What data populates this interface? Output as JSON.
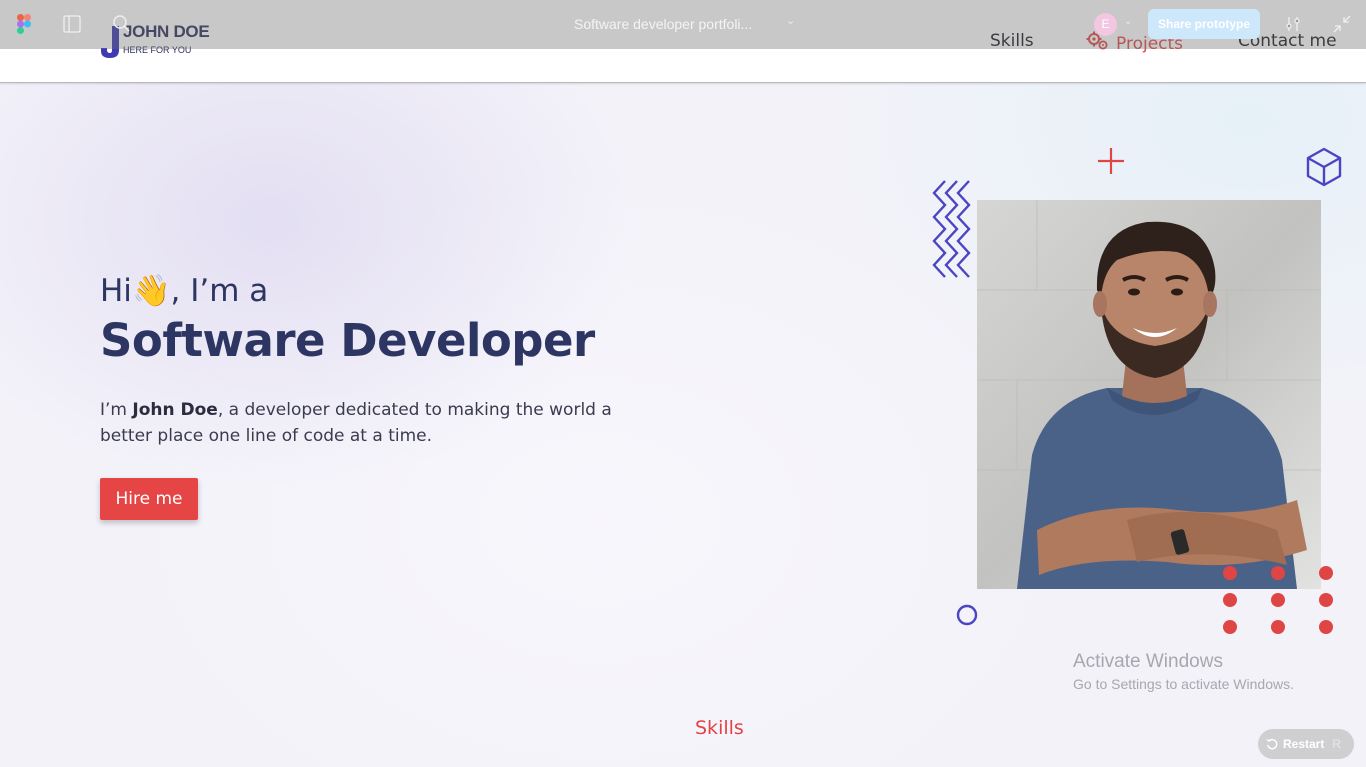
{
  "figma_toolbar": {
    "file_title": "Software developer portfoli...",
    "avatar_initial": "E",
    "share_label": "Share prototype",
    "icons": [
      "figma-logo-icon",
      "sidebar-toggle-icon",
      "search-icon",
      "settings-sliders-icon",
      "collapse-icon"
    ]
  },
  "site_nav": {
    "logo_name": "JOHN DOE",
    "logo_tagline": "HERE FOR YOU",
    "links": [
      {
        "label": "Skills"
      },
      {
        "label": "Projects",
        "icon": "gears-icon",
        "color": "#e04a4a"
      },
      {
        "label": "Contact me"
      }
    ]
  },
  "hero": {
    "greeting_prefix": "Hi",
    "greeting_emoji": "👋",
    "greeting_suffix": ", I’m a",
    "title": "Software Developer",
    "desc_prefix": "I’m ",
    "desc_name": "John Doe",
    "desc_suffix": ", a developer dedicated to making the world a better place one line of code at a time.",
    "cta_label": "Hire me",
    "photo_alt": "Smiling man with beard in blue t-shirt, arms crossed"
  },
  "sections": {
    "next_label": "Skills"
  },
  "watermark": {
    "title": "Activate Windows",
    "subtitle": "Go to Settings to activate Windows."
  },
  "prototype_controls": {
    "restart_label": "Restart",
    "restart_key": "R"
  },
  "colors": {
    "accent_red": "#e64545",
    "navy_text": "#2d3663",
    "deco_purple": "#4a45c2",
    "share_blue": "#cde7fb"
  }
}
